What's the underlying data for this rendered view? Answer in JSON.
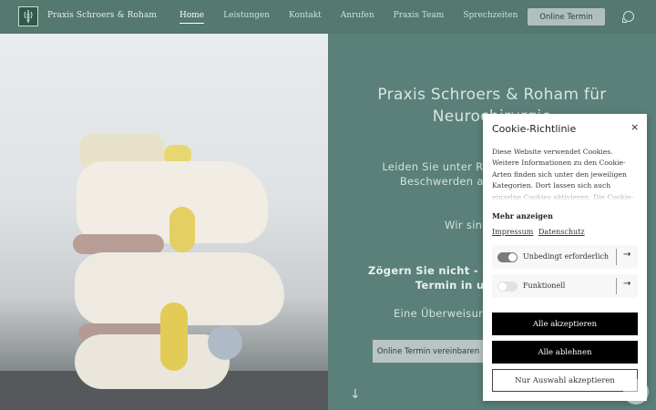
{
  "header": {
    "brand": "Praxis Schroers & Roham",
    "nav": [
      "Home",
      "Leistungen",
      "Kontakt",
      "Anrufen",
      "Praxis Team",
      "Sprechzeiten"
    ],
    "cta": "Online Termin",
    "icons": {
      "logo": "spine-logo-icon",
      "whatsapp": "whatsapp-icon"
    }
  },
  "hero": {
    "title": "Praxis Schroers & Roham für Neurochirurgie",
    "p1": "Leiden Sie unter Rückenschmerzen oder Beschwerden an der Wirbelsäule?",
    "p2": "Wir sind für Sie da.",
    "p3": "Zögern Sie nicht - vereinbaren Sie einen Termin in unserer Praxis.",
    "p4": "Eine Überweisung ist nicht notwendig.",
    "button": "Online Termin vereinbaren",
    "arrow": "↓"
  },
  "cookie": {
    "title": "Cookie-Richtlinie",
    "close": "×",
    "text": "Diese Website verwendet Cookies. Weitere Informationen zu den Cookie-Arten finden sich unter den jeweiligen Kategorien. Dort lassen sich auch einzelne Cookies aktivieren. Die Cookie-Einstellungen",
    "more": "Mehr anzeigen",
    "links": [
      "Impressum",
      "Datenschutz"
    ],
    "categories": [
      {
        "label": "Unbedingt erforderlich",
        "enabled": true
      },
      {
        "label": "Funktionell",
        "enabled": false
      }
    ],
    "arrow": "→",
    "accept_all": "Alle akzeptieren",
    "reject_all": "Alle ablehnen",
    "accept_selection": "Nur Auswahl akzeptieren"
  },
  "colors": {
    "background": "#5a8079",
    "header": "#55786f",
    "button": "#b0bfbc"
  }
}
